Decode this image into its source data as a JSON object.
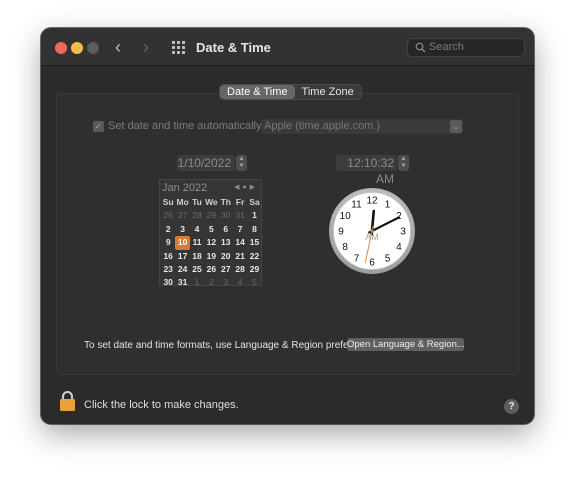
{
  "window": {
    "title": "Date & Time",
    "search_placeholder": "Search",
    "nav_back_icon": "‹",
    "nav_forward_icon": "›"
  },
  "tabs": [
    {
      "label": "Date & Time",
      "selected": true
    },
    {
      "label": "Time Zone",
      "selected": false
    }
  ],
  "auto": {
    "checked": true,
    "label": "Set date and time automatically:",
    "server": "Apple (time.apple.com.)"
  },
  "date_field": "1/10/2022",
  "time_field": "12:10:32 AM",
  "calendar": {
    "month_label": "Jan 2022",
    "weekday_headers": [
      "Su",
      "Mo",
      "Tu",
      "We",
      "Th",
      "Fr",
      "Sa"
    ],
    "weeks": [
      [
        "26",
        "27",
        "28",
        "29",
        "30",
        "31",
        "1"
      ],
      [
        "2",
        "3",
        "4",
        "5",
        "6",
        "7",
        "8"
      ],
      [
        "9",
        "10",
        "11",
        "12",
        "13",
        "14",
        "15"
      ],
      [
        "16",
        "17",
        "18",
        "19",
        "20",
        "21",
        "22"
      ],
      [
        "23",
        "24",
        "25",
        "26",
        "27",
        "28",
        "29"
      ],
      [
        "30",
        "31",
        "1",
        "2",
        "3",
        "4",
        "5"
      ]
    ],
    "selected_day": "10"
  },
  "clock": {
    "am_pm": "AM",
    "numbers": [
      "12",
      "1",
      "2",
      "3",
      "4",
      "5",
      "6",
      "7",
      "8",
      "9",
      "10",
      "11"
    ],
    "hour": 12,
    "minute": 10,
    "second": 32
  },
  "footer": {
    "formats_text": "To set date and time formats, use Language & Region preferences.",
    "formats_button": "Open Language & Region...",
    "lock_text": "Click the lock to make changes.",
    "help_label": "?"
  },
  "colors": {
    "accent": "#d47f2f",
    "lock": "#e8a23c",
    "close": "#ec6a5e",
    "minimize": "#f4bf4f"
  }
}
